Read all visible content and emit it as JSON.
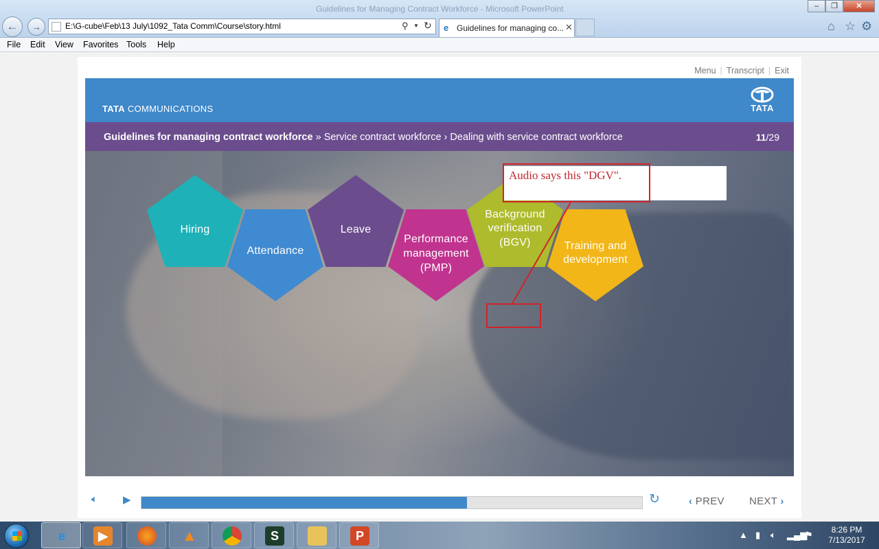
{
  "browser": {
    "window_title": "Guidelines for Managing Contract Workforce - Microsoft PowerPoint",
    "address": "E:\\G-cube\\Feb\\13 July\\1092_Tata Comm\\Course\\story.html",
    "tab_title": "Guidelines for managing co...",
    "menu": [
      "File",
      "Edit",
      "View",
      "Favorites",
      "Tools",
      "Help"
    ],
    "back_icon": "arrow-left-icon",
    "forward_icon": "arrow-right-icon"
  },
  "player": {
    "top_links": [
      "Menu",
      "Transcript",
      "Exit"
    ],
    "brand": {
      "bold": "TATA",
      "rest": " COMMUNICATIONS",
      "logo_text": "TATA"
    },
    "breadcrumb": {
      "course": "Guidelines for managing contract workforce",
      "sep1": " » ",
      "section": "Service contract workforce",
      "sep2": " › ",
      "topic": "Dealing with service contract workforce"
    },
    "page": {
      "current": "11",
      "total": "/29"
    },
    "pentagons": [
      {
        "label_lines": [
          "Hiring"
        ],
        "color": "#1fb1b8"
      },
      {
        "label_lines": [
          "Attendance"
        ],
        "color": "#3f8ad0"
      },
      {
        "label_lines": [
          "Leave"
        ],
        "color": "#6b4d8e"
      },
      {
        "label_lines": [
          "Performance",
          "management",
          "(PMP)"
        ],
        "color": "#c0338e"
      },
      {
        "label_lines": [
          "Background",
          "verification",
          "(BGV)"
        ],
        "color": "#adbb2c"
      },
      {
        "label_lines": [
          "Training and",
          "development"
        ],
        "color": "#f2b619"
      }
    ],
    "annotation": "Audio says this \"DGV\".",
    "annotation_color": "#d2232a",
    "progress_fraction": 0.65,
    "prev_label": "PREV",
    "next_label": "NEXT"
  },
  "taskbar": {
    "time": "8:26 PM",
    "date": "7/13/2017"
  }
}
